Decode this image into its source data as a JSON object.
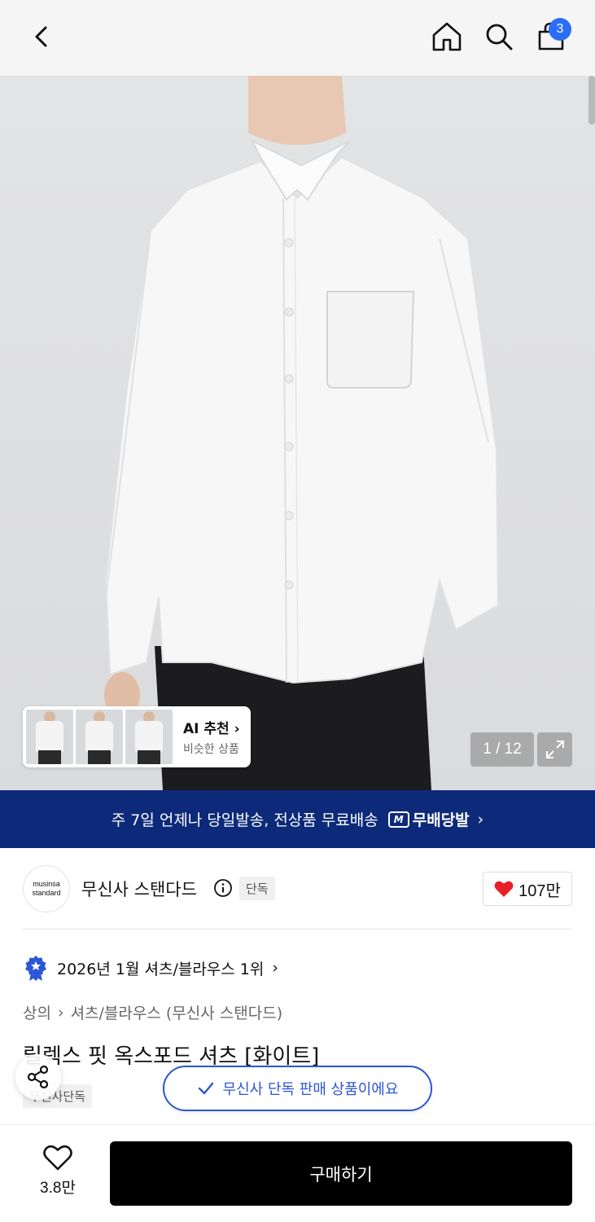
{
  "header": {
    "back_icon": "chevron-left-icon",
    "home_icon": "home-icon",
    "search_icon": "search-icon",
    "cart_icon": "shopping-bag-icon",
    "cart_count": "3"
  },
  "gallery": {
    "counter": "1 / 12",
    "expand_icon": "expand-icon",
    "ai_card": {
      "title": "AI 추천",
      "subtitle": "비슷한 상품"
    }
  },
  "promo_banner": {
    "text": "주 7일 언제나 당일발송, 전상품 무료배송",
    "logo_letter": "M",
    "badge": "무배당발"
  },
  "brand": {
    "logo_line1": "musinsa",
    "logo_line2": "standard",
    "name": "무신사 스탠다드",
    "tag": "단독",
    "likes": "107만"
  },
  "ranking": {
    "text": "2026년 1월 셔츠/블라우스 1위"
  },
  "breadcrumb": {
    "level1": "상의",
    "level2": "셔츠/블라우스 (무신사 스탠다드)"
  },
  "product": {
    "title": "릴렉스 핏 옥스포드 셔츠 [화이트]",
    "tag": "무신사단독"
  },
  "toast": {
    "text": "무신사 단독 판매 상품이에요"
  },
  "bottom_bar": {
    "wish_count": "3.8만",
    "buy_label": "구매하기"
  },
  "colors": {
    "promo_bg": "#0d2a7a",
    "accent_blue": "#2b56d6",
    "badge_blue": "#2b6df5",
    "heart_red": "#e8202a",
    "buy_bg": "#000000"
  }
}
